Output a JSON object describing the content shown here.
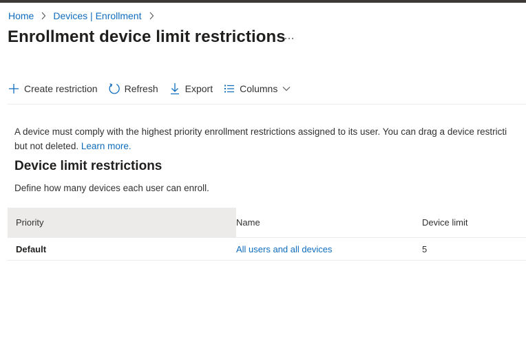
{
  "breadcrumb": {
    "items": [
      "Home",
      "Devices | Enrollment"
    ]
  },
  "page": {
    "title": "Enrollment device limit restrictions",
    "more_label": "..."
  },
  "toolbar": {
    "create_label": "Create restriction",
    "refresh_label": "Refresh",
    "export_label": "Export",
    "columns_label": "Columns"
  },
  "info": {
    "line1": "A device must comply with the highest priority enrollment restrictions assigned to its user. You can drag a device restricti",
    "line2_prefix": "but not deleted.",
    "learn_more": "Learn more."
  },
  "section": {
    "title": "Device limit restrictions",
    "description": "Define how many devices each user can enroll."
  },
  "table": {
    "headers": {
      "priority": "Priority",
      "name": "Name",
      "device_limit": "Device limit"
    },
    "rows": [
      {
        "priority": "Default",
        "name": "All users and all devices",
        "device_limit": "5"
      }
    ]
  },
  "colors": {
    "link": "#0f6cbd",
    "icon_accent": "#0f6cbd",
    "header_highlight": "#edebe9"
  },
  "icons": {
    "create": "plus-icon",
    "refresh": "refresh-icon",
    "export": "download-icon",
    "columns": "list-icon",
    "columns_dropdown": "chevron-down-icon",
    "breadcrumb_separator": "chevron-right-icon",
    "more": "ellipsis-icon"
  }
}
